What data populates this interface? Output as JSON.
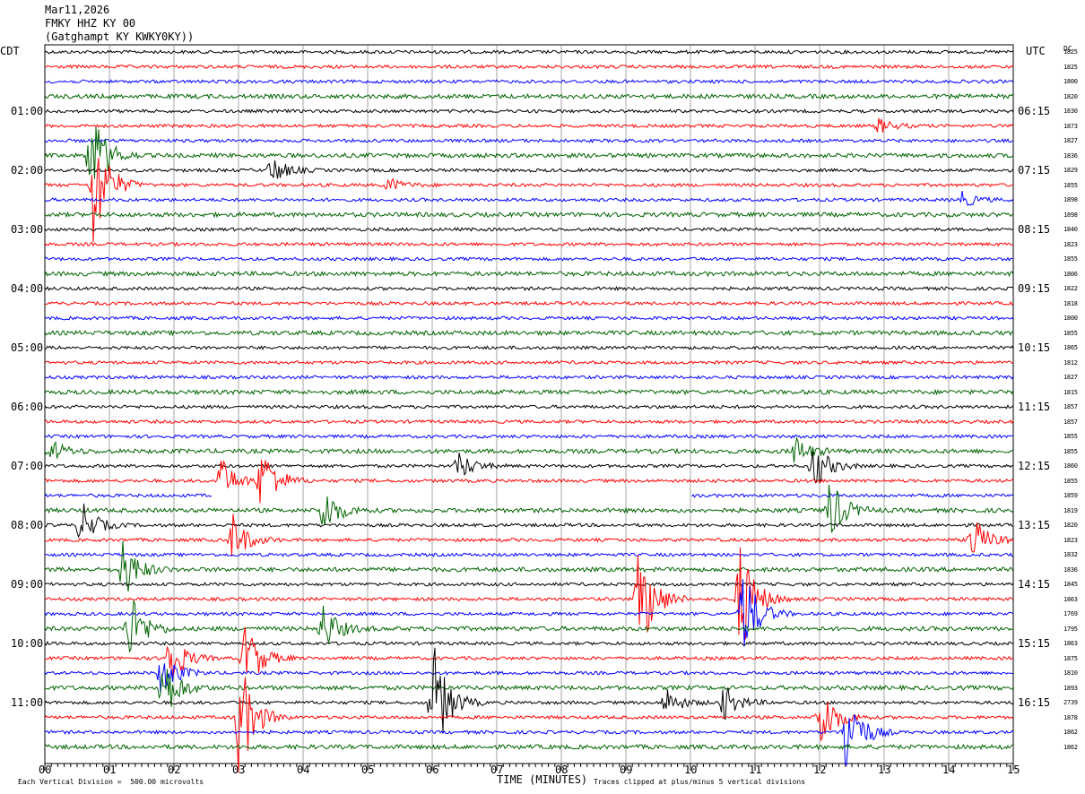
{
  "header": {
    "date": "Mar11,2026",
    "station": "FMKY HHZ KY 00",
    "location": "(Gatghampt KY KWKY0KY))"
  },
  "left_axis_title": "CDT",
  "right_axis_title": "UTC",
  "right_corner_label": "DC",
  "xlabel": "TIME (MINUTES)",
  "footer_left": "Each Vertical Division =  500.00 microvolts",
  "footer_right": "Traces clipped at plus/minus 5 vertical divisions",
  "colors": {
    "black": "#000000",
    "red": "#ff0000",
    "blue": "#0000ff",
    "green": "#006400",
    "grid": "#808080"
  },
  "chart_data": {
    "type": "line",
    "title": "FMKY HHZ KY 00",
    "xlabel": "TIME (MINUTES)",
    "xlim": [
      0,
      15
    ],
    "x_ticks": [
      "00",
      "01",
      "02",
      "03",
      "04",
      "05",
      "06",
      "07",
      "08",
      "09",
      "10",
      "11",
      "12",
      "13",
      "14",
      "15"
    ],
    "trace_count": 48,
    "trace_color_cycle": [
      "black",
      "red",
      "blue",
      "green"
    ],
    "left_time_labels": [
      "01:00",
      "02:00",
      "03:00",
      "04:00",
      "05:00",
      "06:00",
      "07:00",
      "08:00",
      "09:00",
      "10:00",
      "11:00"
    ],
    "right_time_labels": [
      "06:15",
      "07:15",
      "08:15",
      "09:15",
      "10:15",
      "11:15",
      "12:15",
      "13:15",
      "14:15",
      "15:15",
      "16:15"
    ],
    "right_values": [
      "1825",
      "1825",
      "1800",
      "1820",
      "1830",
      "1873",
      "1827",
      "1836",
      "1829",
      "1855",
      "1898",
      "1898",
      "1840",
      "1823",
      "1855",
      "1806",
      "1822",
      "1818",
      "1800",
      "1855",
      "1865",
      "1812",
      "1827",
      "1815",
      "1857",
      "1857",
      "1855",
      "1855",
      "1860",
      "1855",
      "1859",
      "1819",
      "1820",
      "1823",
      "1832",
      "1836",
      "1845",
      "1863",
      "1769",
      "1795",
      "1863",
      "1875",
      "1810",
      "1893",
      "2739",
      "1878",
      "1862",
      "1862"
    ],
    "events": [
      {
        "trace": 5,
        "minute": 12.9,
        "amp": 0.6
      },
      {
        "trace": 7,
        "minute": 0.7,
        "amp": 4
      },
      {
        "trace": 8,
        "minute": 3.5,
        "amp": 1.2
      },
      {
        "trace": 9,
        "minute": 0.75,
        "amp": 5
      },
      {
        "trace": 9,
        "minute": 5.3,
        "amp": 0.6
      },
      {
        "trace": 10,
        "minute": 14.2,
        "amp": 0.6
      },
      {
        "trace": 27,
        "minute": 0.1,
        "amp": 0.8
      },
      {
        "trace": 27,
        "minute": 11.6,
        "amp": 1.2
      },
      {
        "trace": 28,
        "minute": 6.4,
        "amp": 1.2
      },
      {
        "trace": 28,
        "minute": 11.9,
        "amp": 2
      },
      {
        "trace": 29,
        "minute": 2.7,
        "amp": 2
      },
      {
        "trace": 29,
        "minute": 3.35,
        "amp": 3
      },
      {
        "trace": 31,
        "minute": 4.3,
        "amp": 2
      },
      {
        "trace": 31,
        "minute": 12.15,
        "amp": 2.5
      },
      {
        "trace": 32,
        "minute": 0.55,
        "amp": 2
      },
      {
        "trace": 33,
        "minute": 2.9,
        "amp": 2
      },
      {
        "trace": 33,
        "minute": 14.35,
        "amp": 2
      },
      {
        "trace": 35,
        "minute": 1.2,
        "amp": 2.5
      },
      {
        "trace": 37,
        "minute": 9.2,
        "amp": 5
      },
      {
        "trace": 37,
        "minute": 10.75,
        "amp": 5
      },
      {
        "trace": 38,
        "minute": 10.8,
        "amp": 4
      },
      {
        "trace": 39,
        "minute": 1.3,
        "amp": 3
      },
      {
        "trace": 39,
        "minute": 4.3,
        "amp": 2
      },
      {
        "trace": 41,
        "minute": 3.1,
        "amp": 3
      },
      {
        "trace": 41,
        "minute": 1.9,
        "amp": 2.5
      },
      {
        "trace": 42,
        "minute": 1.8,
        "amp": 2
      },
      {
        "trace": 43,
        "minute": 1.8,
        "amp": 3
      },
      {
        "trace": 44,
        "minute": 6.0,
        "amp": 5
      },
      {
        "trace": 44,
        "minute": 9.6,
        "amp": 1.2
      },
      {
        "trace": 44,
        "minute": 10.5,
        "amp": 1.5
      },
      {
        "trace": 45,
        "minute": 3.0,
        "amp": 5
      },
      {
        "trace": 45,
        "minute": 12.0,
        "amp": 3
      },
      {
        "trace": 46,
        "minute": 12.4,
        "amp": 4
      }
    ],
    "gaps": [
      {
        "trace": 30,
        "from": 2.6,
        "to": 10.0
      }
    ]
  }
}
